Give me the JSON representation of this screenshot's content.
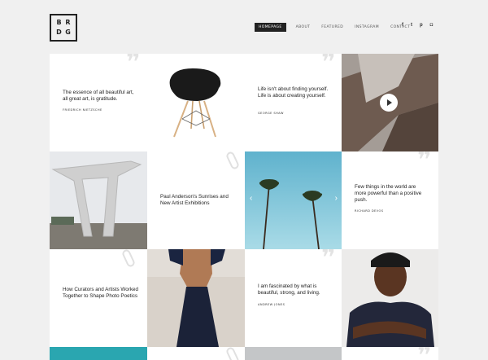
{
  "logo": {
    "letters": [
      "B",
      "R",
      "D",
      "G"
    ]
  },
  "nav": [
    {
      "label": "HOMEPAGE",
      "active": true
    },
    {
      "label": "ABOUT"
    },
    {
      "label": "FEATURED"
    },
    {
      "label": "INSTAGRAM"
    },
    {
      "label": "CONTACT"
    }
  ],
  "social": [
    {
      "icon": "facebook-icon",
      "glyph": "f"
    },
    {
      "icon": "twitter-icon",
      "glyph": "t"
    },
    {
      "icon": "pinterest-icon",
      "glyph": "p"
    },
    {
      "icon": "instagram-icon",
      "glyph": "◘"
    }
  ],
  "tiles": {
    "quote1": {
      "text": "The essence of all beautiful art, all great art, is gratitude.",
      "author": "FRIEDRICH NIETZSCHE"
    },
    "quote2": {
      "text": "Life isn't about finding yourself. Life is about creating yourself.",
      "author": "GEORGE SHAW"
    },
    "article1": {
      "title": "Paul Anderson's Sunrises and New Artist Exhibitions"
    },
    "quote3": {
      "text": "Few things in the world are more powerful than a positive push.",
      "author": "RICHARD DEVOS"
    },
    "article2": {
      "title": "How Curators and Artists Worked Together to Shape Photo Poetics"
    },
    "quote4": {
      "text": "I am fascinated by what is beautiful, strong, and living.",
      "author": "ANDREW JONES"
    }
  },
  "slider": {
    "prev_glyph": "‹",
    "next_glyph": "›"
  },
  "colors": {
    "accent": "#222222",
    "background": "#f0f0f0",
    "tile": "#ffffff",
    "sky": "#7cc3d9"
  }
}
